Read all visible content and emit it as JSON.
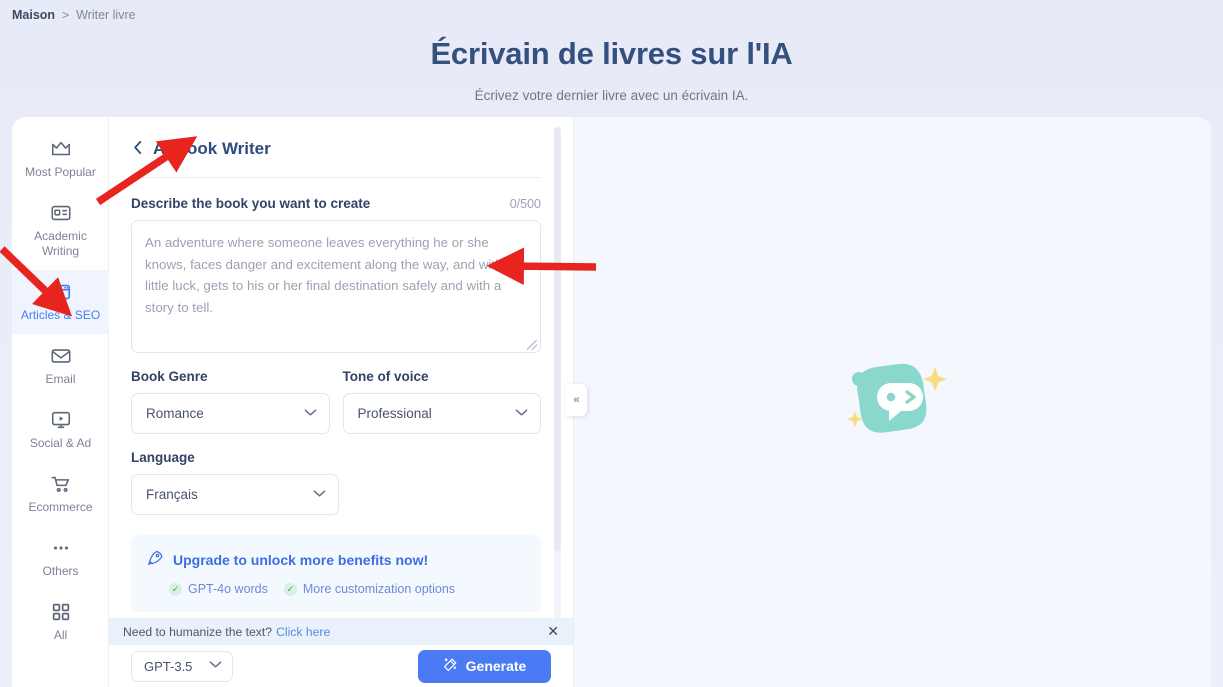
{
  "breadcrumb": {
    "home": "Maison",
    "separator": ">",
    "current": "Writer livre"
  },
  "header": {
    "title": "Écrivain de livres sur l'IA",
    "subtitle": "Écrivez votre dernier livre avec un écrivain IA."
  },
  "sidebar": {
    "items": [
      {
        "label": "Most Popular",
        "icon": "crown-icon",
        "active": false
      },
      {
        "label": "Academic Writing",
        "icon": "id-card-icon",
        "active": false
      },
      {
        "label": "Articles & SEO",
        "icon": "browser-window-icon",
        "active": true
      },
      {
        "label": "Email",
        "icon": "envelope-icon",
        "active": false
      },
      {
        "label": "Social & Ad",
        "icon": "monitor-play-icon",
        "active": false
      },
      {
        "label": "Ecommerce",
        "icon": "shopping-cart-icon",
        "active": false
      },
      {
        "label": "Others",
        "icon": "ellipsis-icon",
        "active": false
      },
      {
        "label": "All",
        "icon": "grid-icon",
        "active": false
      }
    ]
  },
  "form": {
    "back_icon": "chevron-left-icon",
    "panel_title": "AI Book Writer",
    "describe_label": "Describe the book you want to create",
    "counter": "0/500",
    "describe_value": "",
    "describe_placeholder": "An adventure where someone leaves everything he or she knows, faces danger and excitement along the way, and with a little luck, gets to his or her final destination safely and with a story to tell.",
    "genre_label": "Book Genre",
    "genre_value": "Romance",
    "tone_label": "Tone of voice",
    "tone_value": "Professional",
    "language_label": "Language",
    "language_value": "Français",
    "dropdown_icon": "chevron-down-icon"
  },
  "upgrade": {
    "icon": "rocket-icon",
    "title": "Upgrade to unlock more benefits now!",
    "benefits": [
      {
        "check": "check-icon",
        "label": "GPT-4o words"
      },
      {
        "check": "check-icon",
        "label": "More customization options"
      }
    ]
  },
  "humanize": {
    "text": "Need to humanize the text?",
    "link": "Click here",
    "close_icon": "close-icon",
    "close_glyph": "✕"
  },
  "bottom": {
    "model_value": "GPT-3.5",
    "model_icon": "chevron-down-icon",
    "generate_label": "Generate",
    "generate_icon": "magic-wand-icon"
  },
  "collapse": {
    "icon": "double-chevron-left-icon",
    "glyph": "«"
  },
  "right_panel": {
    "illustration": "chat-robot-mascot-illustration"
  },
  "colors": {
    "accent_blue": "#4a7bf4",
    "title_navy": "#33507e",
    "page_bg": "#e9ecf8",
    "right_panel_bg": "#f4f8fe",
    "mascot_teal": "#8ad8cd",
    "sparkle_yellow": "#f7dd82",
    "arrow_red": "#e8241f"
  }
}
